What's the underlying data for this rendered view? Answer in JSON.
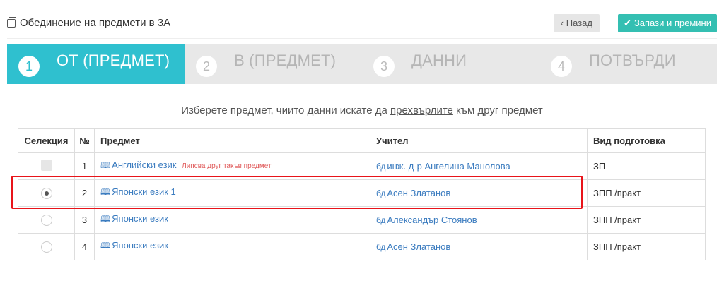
{
  "header": {
    "title": "Обединение на предмети в 3А",
    "back_label": "Назад",
    "save_label": "Запази и премини"
  },
  "steps": [
    {
      "num": "1",
      "label": "ОТ (ПРЕДМЕТ)",
      "active": true
    },
    {
      "num": "2",
      "label": "В (ПРЕДМЕТ)",
      "active": false
    },
    {
      "num": "3",
      "label": "ДАННИ",
      "active": false
    },
    {
      "num": "4",
      "label": "ПОТВЪРДИ",
      "active": false
    }
  ],
  "instruction": {
    "before": "Изберете предмет, чиито данни искате да ",
    "underlined": "прехвърлите",
    "after": " към друг предмет"
  },
  "table": {
    "headers": [
      "Селекция",
      "№",
      "Предмет",
      "Учител",
      "Вид подготовка"
    ],
    "rows": [
      {
        "num": "1",
        "subject": "Английски език",
        "note": "Липсва друг такъв предмет",
        "teacher": "инж. д-р Ангелина Манолова",
        "prep": "ЗП",
        "selection": "disabled"
      },
      {
        "num": "2",
        "subject": "Японски език 1",
        "note": "",
        "teacher": "Асен Златанов",
        "prep": "ЗПП /практ",
        "selection": "selected"
      },
      {
        "num": "3",
        "subject": "Японски език",
        "note": "",
        "teacher": "Александър Стоянов",
        "prep": "ЗПП /практ",
        "selection": "unselected"
      },
      {
        "num": "4",
        "subject": "Японски език",
        "note": "",
        "teacher": "Асен Златанов",
        "prep": "ЗПП /практ",
        "selection": "unselected"
      }
    ]
  },
  "colors": {
    "accent": "#2fc0cf",
    "save_button": "#34bfb2",
    "link": "#3a7bbf",
    "warning": "#e05a5a",
    "highlight": "#e8141a"
  }
}
